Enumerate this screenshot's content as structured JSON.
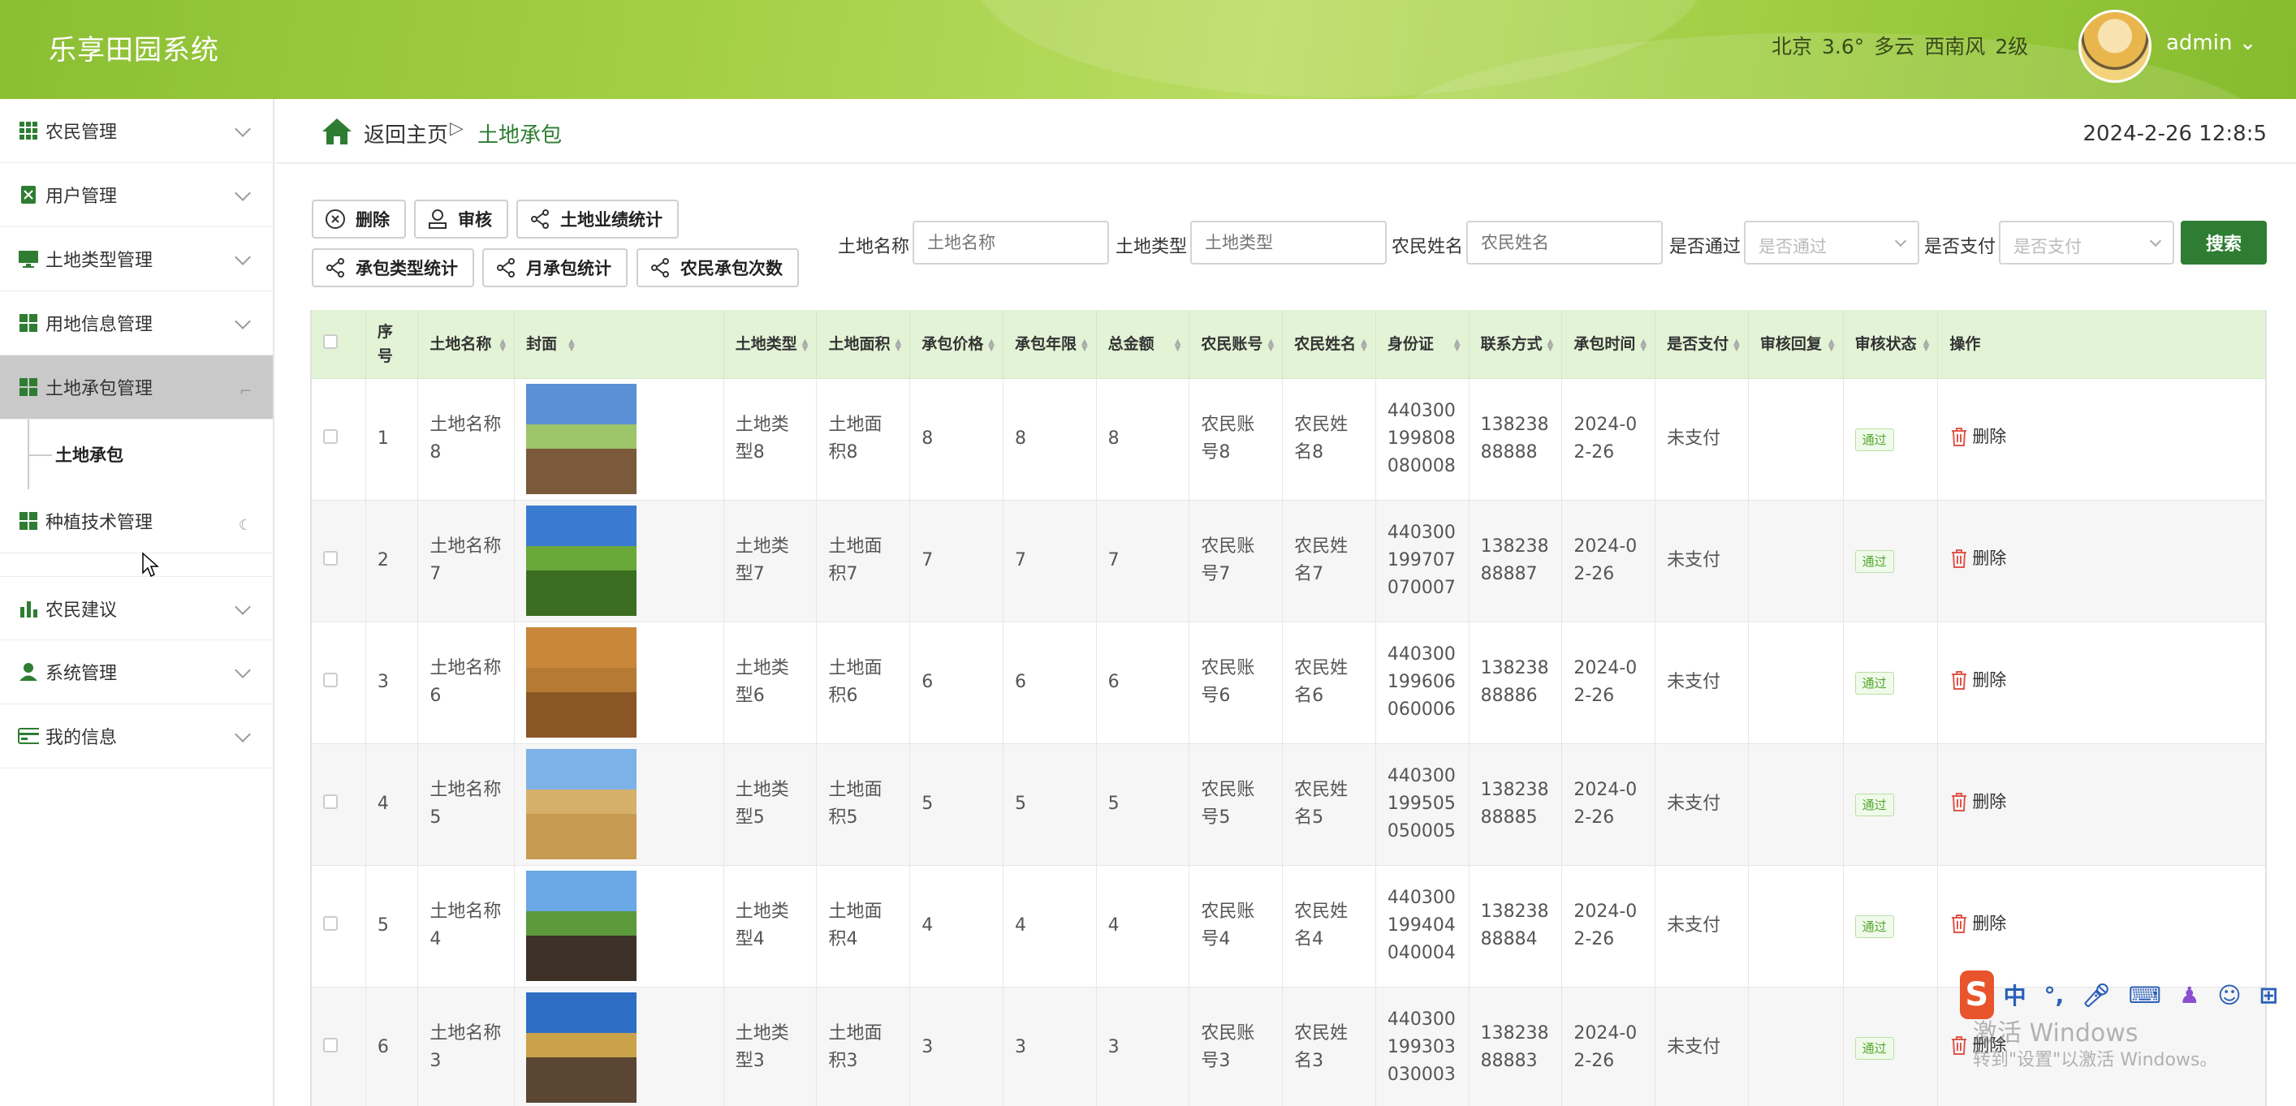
{
  "header": {
    "app_title": "乐享田园系统",
    "weather": {
      "city": "北京",
      "temp": "3.6°",
      "condition": "多云",
      "wind": "西南风",
      "level": "2级"
    },
    "user": "admin ⌄"
  },
  "sidebar": {
    "items": [
      {
        "label": "农民管理",
        "icon": "grid-icon"
      },
      {
        "label": "用户管理",
        "icon": "user-doc-icon"
      },
      {
        "label": "土地类型管理",
        "icon": "monitor-icon"
      },
      {
        "label": "用地信息管理",
        "icon": "grid-icon"
      },
      {
        "label": "土地承包管理",
        "icon": "grid-icon",
        "active": true
      },
      {
        "label": "种植技术管理",
        "icon": "grid-icon"
      },
      {
        "label": "农民建议",
        "icon": "bar-chart-icon"
      },
      {
        "label": "系统管理",
        "icon": "person-icon"
      },
      {
        "label": "我的信息",
        "icon": "card-icon"
      }
    ],
    "submenu_label": "土地承包"
  },
  "breadcrumb": {
    "home": "返回主页",
    "separator": "▷",
    "current": "土地承包"
  },
  "clock": "2024-2-26 12:8:5",
  "toolbar": {
    "delete": "删除",
    "review": "审核",
    "land_stats": "土地业绩统计",
    "type_stats": "承包类型统计",
    "month_stats": "月承包统计",
    "farmer_count": "农民承包次数"
  },
  "filters": {
    "land_name_label": "土地名称",
    "land_name_placeholder": "土地名称",
    "land_type_label": "土地类型",
    "land_type_placeholder": "土地类型",
    "farmer_name_label": "农民姓名",
    "farmer_name_placeholder": "农民姓名",
    "passed_label": "是否通过",
    "passed_placeholder": "是否通过",
    "paid_label": "是否支付",
    "paid_placeholder": "是否支付",
    "search_button": "搜索"
  },
  "table": {
    "headers": {
      "index": "序号",
      "land_name": "土地名称",
      "cover": "封面",
      "land_type": "土地类型",
      "land_area": "土地面积",
      "price": "承包价格",
      "years": "承包年限",
      "total": "总金额",
      "farmer_account": "农民账号",
      "farmer_name": "农民姓名",
      "id_card": "身份证",
      "contact": "联系方式",
      "time": "承包时间",
      "paid": "是否支付",
      "reply": "审核回复",
      "status": "审核状态",
      "actions": "操作"
    },
    "delete_label": "删除",
    "rows": [
      {
        "index": "1",
        "land_name": "土地名称8",
        "land_type": "土地类型8",
        "land_area": "土地面积8",
        "price": "8",
        "years": "8",
        "total": "8",
        "farmer_account": "农民账号8",
        "farmer_name": "农民姓名8",
        "id_card": "440300199808080008",
        "contact": "13823888888",
        "time": "2024-02-26",
        "paid": "未支付",
        "reply": "",
        "status": "通过"
      },
      {
        "index": "2",
        "land_name": "土地名称7",
        "land_type": "土地类型7",
        "land_area": "土地面积7",
        "price": "7",
        "years": "7",
        "total": "7",
        "farmer_account": "农民账号7",
        "farmer_name": "农民姓名7",
        "id_card": "440300199707070007",
        "contact": "13823888887",
        "time": "2024-02-26",
        "paid": "未支付",
        "reply": "",
        "status": "通过"
      },
      {
        "index": "3",
        "land_name": "土地名称6",
        "land_type": "土地类型6",
        "land_area": "土地面积6",
        "price": "6",
        "years": "6",
        "total": "6",
        "farmer_account": "农民账号6",
        "farmer_name": "农民姓名6",
        "id_card": "440300199606060006",
        "contact": "13823888886",
        "time": "2024-02-26",
        "paid": "未支付",
        "reply": "",
        "status": "通过"
      },
      {
        "index": "4",
        "land_name": "土地名称5",
        "land_type": "土地类型5",
        "land_area": "土地面积5",
        "price": "5",
        "years": "5",
        "total": "5",
        "farmer_account": "农民账号5",
        "farmer_name": "农民姓名5",
        "id_card": "440300199505050005",
        "contact": "13823888885",
        "time": "2024-02-26",
        "paid": "未支付",
        "reply": "",
        "status": "通过"
      },
      {
        "index": "5",
        "land_name": "土地名称4",
        "land_type": "土地类型4",
        "land_area": "土地面积4",
        "price": "4",
        "years": "4",
        "total": "4",
        "farmer_account": "农民账号4",
        "farmer_name": "农民姓名4",
        "id_card": "440300199404040004",
        "contact": "13823888884",
        "time": "2024-02-26",
        "paid": "未支付",
        "reply": "",
        "status": "通过"
      },
      {
        "index": "6",
        "land_name": "土地名称3",
        "land_type": "土地类型3",
        "land_area": "土地面积3",
        "price": "3",
        "years": "3",
        "total": "3",
        "farmer_account": "农民账号3",
        "farmer_name": "农民姓名3",
        "id_card": "440300199303030003",
        "contact": "13823888883",
        "time": "2024-02-26",
        "paid": "未支付",
        "reply": "",
        "status": "通过"
      }
    ]
  },
  "ime": {
    "lang": "中",
    "punct": "°,"
  },
  "watermark": {
    "line1": "激活 Windows",
    "line2": "转到\"设置\"以激活 Windows。"
  },
  "colors": {
    "primary": "#2e7d32",
    "header": "#a3cf45",
    "table_header": "#e2f3d6",
    "badge": "#52a62f"
  }
}
